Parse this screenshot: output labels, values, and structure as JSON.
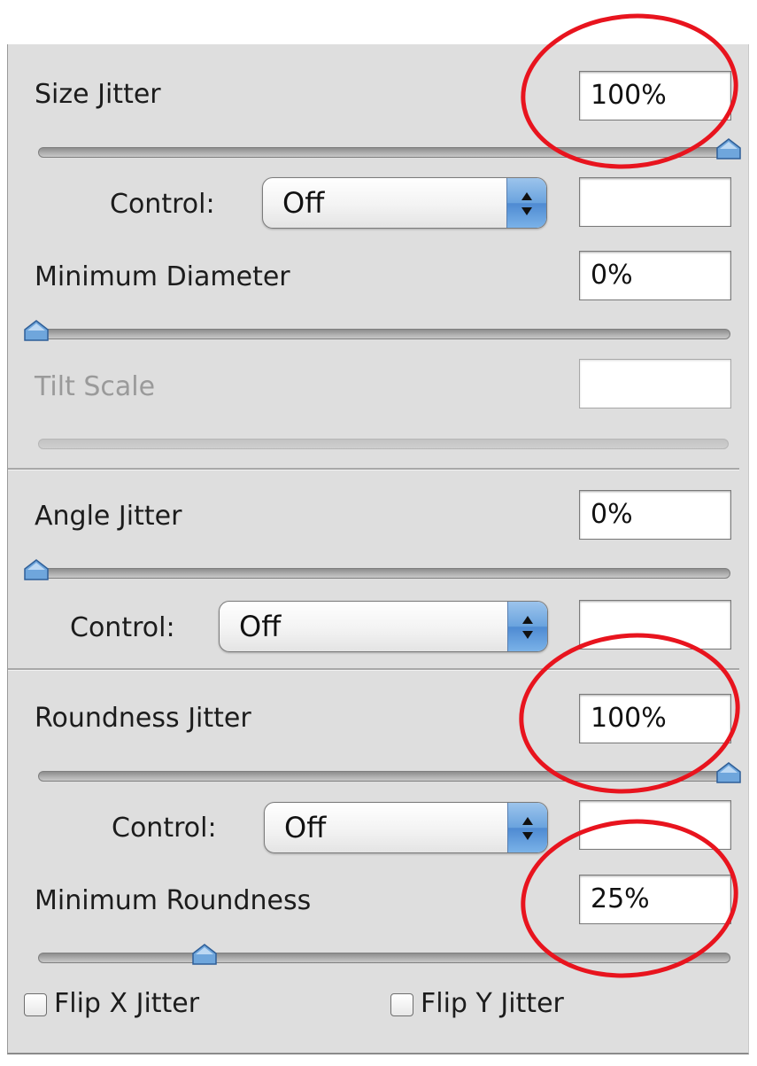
{
  "size_jitter": {
    "label": "Size Jitter",
    "value": "100%",
    "slider_fraction": 1.0
  },
  "size_control": {
    "label": "Control:",
    "selected": "Off",
    "value": ""
  },
  "minimum_diameter": {
    "label": "Minimum Diameter",
    "value": "0%",
    "slider_fraction": 0.0
  },
  "tilt_scale": {
    "label": "Tilt Scale",
    "value": "",
    "disabled": true
  },
  "angle_jitter": {
    "label": "Angle Jitter",
    "value": "0%",
    "slider_fraction": 0.0
  },
  "angle_control": {
    "label": "Control:",
    "selected": "Off",
    "value": ""
  },
  "roundness_jitter": {
    "label": "Roundness Jitter",
    "value": "100%",
    "slider_fraction": 1.0
  },
  "roundness_control": {
    "label": "Control:",
    "selected": "Off",
    "value": ""
  },
  "minimum_roundness": {
    "label": "Minimum Roundness",
    "value": "25%",
    "slider_fraction": 0.25
  },
  "flip_x": {
    "label": "Flip X Jitter",
    "checked": false
  },
  "flip_y": {
    "label": "Flip Y Jitter",
    "checked": false
  },
  "colors": {
    "annotation_ring": "#e8141e",
    "thumb": "#6fa6dc",
    "panel": "#dedede"
  },
  "icons": {
    "select_arrows": "up-down-chevron-icon",
    "slider_thumb": "slider-thumb-icon"
  }
}
